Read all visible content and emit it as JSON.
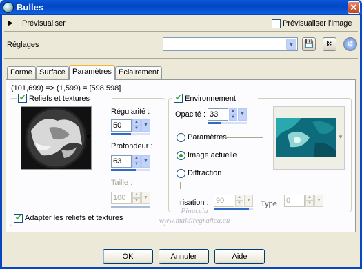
{
  "window": {
    "title": "Bulles"
  },
  "preview_row": {
    "label": "Prévisualiser",
    "checkbox_label": "Prévisualiser l'image"
  },
  "presets": {
    "label": "Réglages",
    "value": ""
  },
  "tabs": [
    {
      "label": "Forme"
    },
    {
      "label": "Surface"
    },
    {
      "label": "Paramètres"
    },
    {
      "label": "Éclairement"
    }
  ],
  "coords_readout": "(101,699) => (1,599) = [598,598]",
  "reliefs": {
    "checkbox_label": "Reliefs et textures",
    "regularite": {
      "label": "Régularité :",
      "value": "50",
      "fraction": 0.5
    },
    "profondeur": {
      "label": "Profondeur :",
      "value": "63",
      "fraction": 0.63
    },
    "taille": {
      "label": "Taille :",
      "value": "100",
      "fraction": 1.0
    },
    "adapt_label": "Adapter les reliefs et textures"
  },
  "environnement": {
    "checkbox_label": "Environnement",
    "opacite": {
      "label": "Opacité :",
      "value": "33",
      "fraction": 0.33
    },
    "options": [
      {
        "label": "Paramètres"
      },
      {
        "label": "Image actuelle"
      },
      {
        "label": "Diffraction"
      }
    ],
    "irisation": {
      "label": "Irisation :",
      "value": "90",
      "fraction": 0.9
    },
    "type": {
      "label": "Type",
      "value": "0"
    }
  },
  "watermark": {
    "line1": "Pinuccia",
    "line2": "www.maldiregrafica.eu"
  },
  "buttons": {
    "ok": "OK",
    "annuler": "Annuler",
    "aide": "Aide"
  },
  "colors": {
    "accent": "#316ac5",
    "titlebar": "#0246c1",
    "check": "#21a121"
  }
}
